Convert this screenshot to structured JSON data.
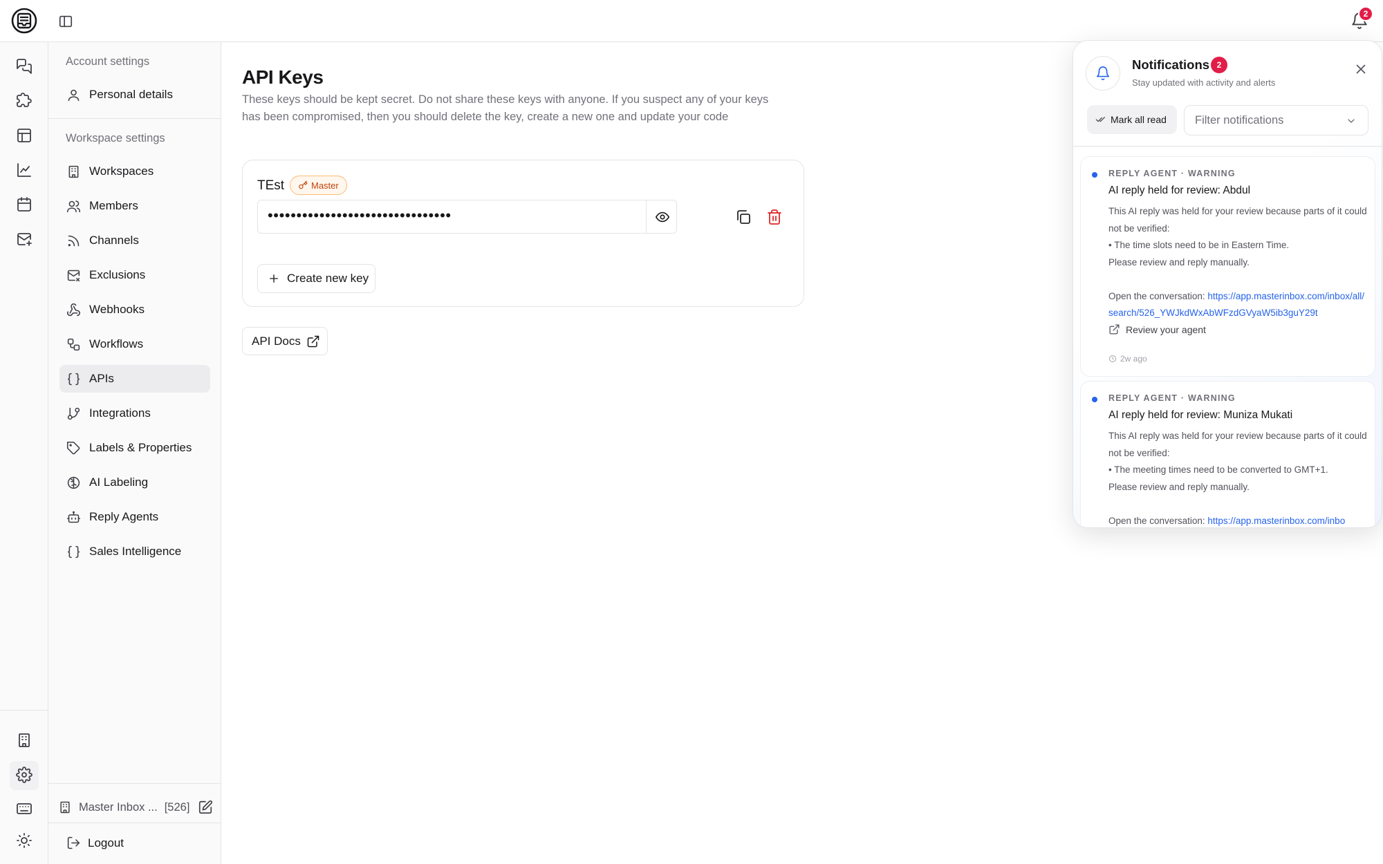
{
  "header": {
    "notification_count": "2"
  },
  "rail": {
    "top_icons": [
      "chat-icon",
      "puzzle-icon",
      "table-icon",
      "analytics-icon",
      "calendar-icon",
      "mail-plus-icon"
    ],
    "bottom_icons": [
      "building-icon",
      "gear-icon",
      "keyboard-icon",
      "sun-icon"
    ]
  },
  "sidebar": {
    "account_title": "Account settings",
    "personal_details": "Personal details",
    "workspace_title": "Workspace settings",
    "items": [
      {
        "label": "Workspaces",
        "icon": "building-icon"
      },
      {
        "label": "Members",
        "icon": "users-icon"
      },
      {
        "label": "Channels",
        "icon": "rss-icon"
      },
      {
        "label": "Exclusions",
        "icon": "mail-x-icon"
      },
      {
        "label": "Webhooks",
        "icon": "webhook-icon"
      },
      {
        "label": "Workflows",
        "icon": "workflow-icon"
      },
      {
        "label": "APIs",
        "icon": "braces-icon",
        "active": true
      },
      {
        "label": "Integrations",
        "icon": "git-branch-icon"
      },
      {
        "label": "Labels & Properties",
        "icon": "tag-icon"
      },
      {
        "label": "AI Labeling",
        "icon": "brain-icon"
      },
      {
        "label": "Reply Agents",
        "icon": "bot-icon"
      },
      {
        "label": "Sales Intelligence",
        "icon": "braces-icon"
      }
    ],
    "workspace_name": "Master Inbox ...",
    "workspace_count": "[526]",
    "logout": "Logout"
  },
  "main": {
    "title": "API Keys",
    "description": "These keys should be kept secret. Do not share these keys with anyone. If you suspect any of your keys has been compromised, then you should delete the key, create a new one and update your code",
    "key": {
      "name": "TEst",
      "badge": "Master",
      "masked_value": "••••••••••••••••••••••••••••••••"
    },
    "create_button": "Create new key",
    "docs_button": "API Docs"
  },
  "notifications": {
    "title": "Notifications",
    "count": "2",
    "subtitle": "Stay updated with activity and alerts",
    "mark_all": "Mark all read",
    "filter_placeholder": "Filter notifications",
    "items": [
      {
        "meta": "REPLY AGENT · WARNING",
        "title": "AI reply held for review: Abdul",
        "line1": "This AI reply was held for your review because parts of it could not be verified:",
        "line2": "• The time slots need to be in Eastern Time.",
        "line3": "Please review and reply manually.",
        "open_label": "Open the conversation: ",
        "link": "https://app.masterinbox.com/inbox/all/search/526_YWJkdWxAbWFzdGVyaW5ib3guY29t",
        "review": "Review your agent",
        "time": "2w ago"
      },
      {
        "meta": "REPLY AGENT · WARNING",
        "title": "AI reply held for review: Muniza Mukati",
        "line1": "This AI reply was held for your review because parts of it could not be verified:",
        "line2": "• The meeting times need to be converted to GMT+1.",
        "line3": "Please review and reply manually.",
        "open_label": "Open the conversation: ",
        "link": "https://app.masterinbox.com/inbo"
      }
    ]
  }
}
